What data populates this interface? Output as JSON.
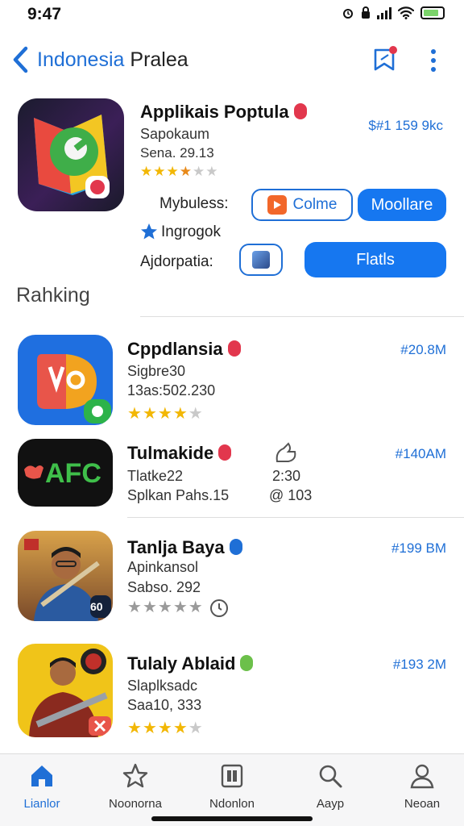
{
  "status": {
    "time": "9:47"
  },
  "nav": {
    "title_blue": "Indonesia",
    "title_dark": "Pralea"
  },
  "featured": {
    "name": "Applikais Poptula",
    "price": "$#1 159 9kc",
    "subtitle1": "Sapokaum",
    "subtitle2": "Sena. 29.13",
    "rating": 3.5,
    "row1_label": "Mybuless:",
    "row1_outline_btn": "Colme",
    "row1_fill_btn": "Moollare",
    "row2_label": "Ingrogok",
    "row3_label": "Ajdorpatia:",
    "row3_fill_btn": "Flatls"
  },
  "section": {
    "title": "Rahking"
  },
  "apps": [
    {
      "name": "Cppdlansia",
      "line1": "Sigbre30",
      "line2": "13as:502.230",
      "price": "#20.8M",
      "rating": 4,
      "badge": "red"
    },
    {
      "name": "Tulmakide",
      "line1": "Tlatke22",
      "line2": "Splkan Pahs.15",
      "extra1": "2:30",
      "extra2": "@ 103",
      "price": "#140AM",
      "badge": "red",
      "icon_text": "AFC"
    },
    {
      "name": "Tanlja Baya",
      "line1": "Apinkansol",
      "line2": "Sabso. 292",
      "price": "#199 BM",
      "rating": 0,
      "badge": "blue",
      "icon_tag": "60"
    },
    {
      "name": "Tulaly Ablaid",
      "line1": "Slaplksadc",
      "line2": "Saa10, 333",
      "price": "#193 2M",
      "rating": 4,
      "badge": "green"
    }
  ],
  "tabs": [
    {
      "label": "Lianlor",
      "icon": "home-icon",
      "active": true
    },
    {
      "label": "Noonorna",
      "icon": "star-icon"
    },
    {
      "label": "Ndonlon",
      "icon": "apps-icon"
    },
    {
      "label": "Aayp",
      "icon": "search-icon"
    },
    {
      "label": "Neoan",
      "icon": "person-icon"
    }
  ]
}
